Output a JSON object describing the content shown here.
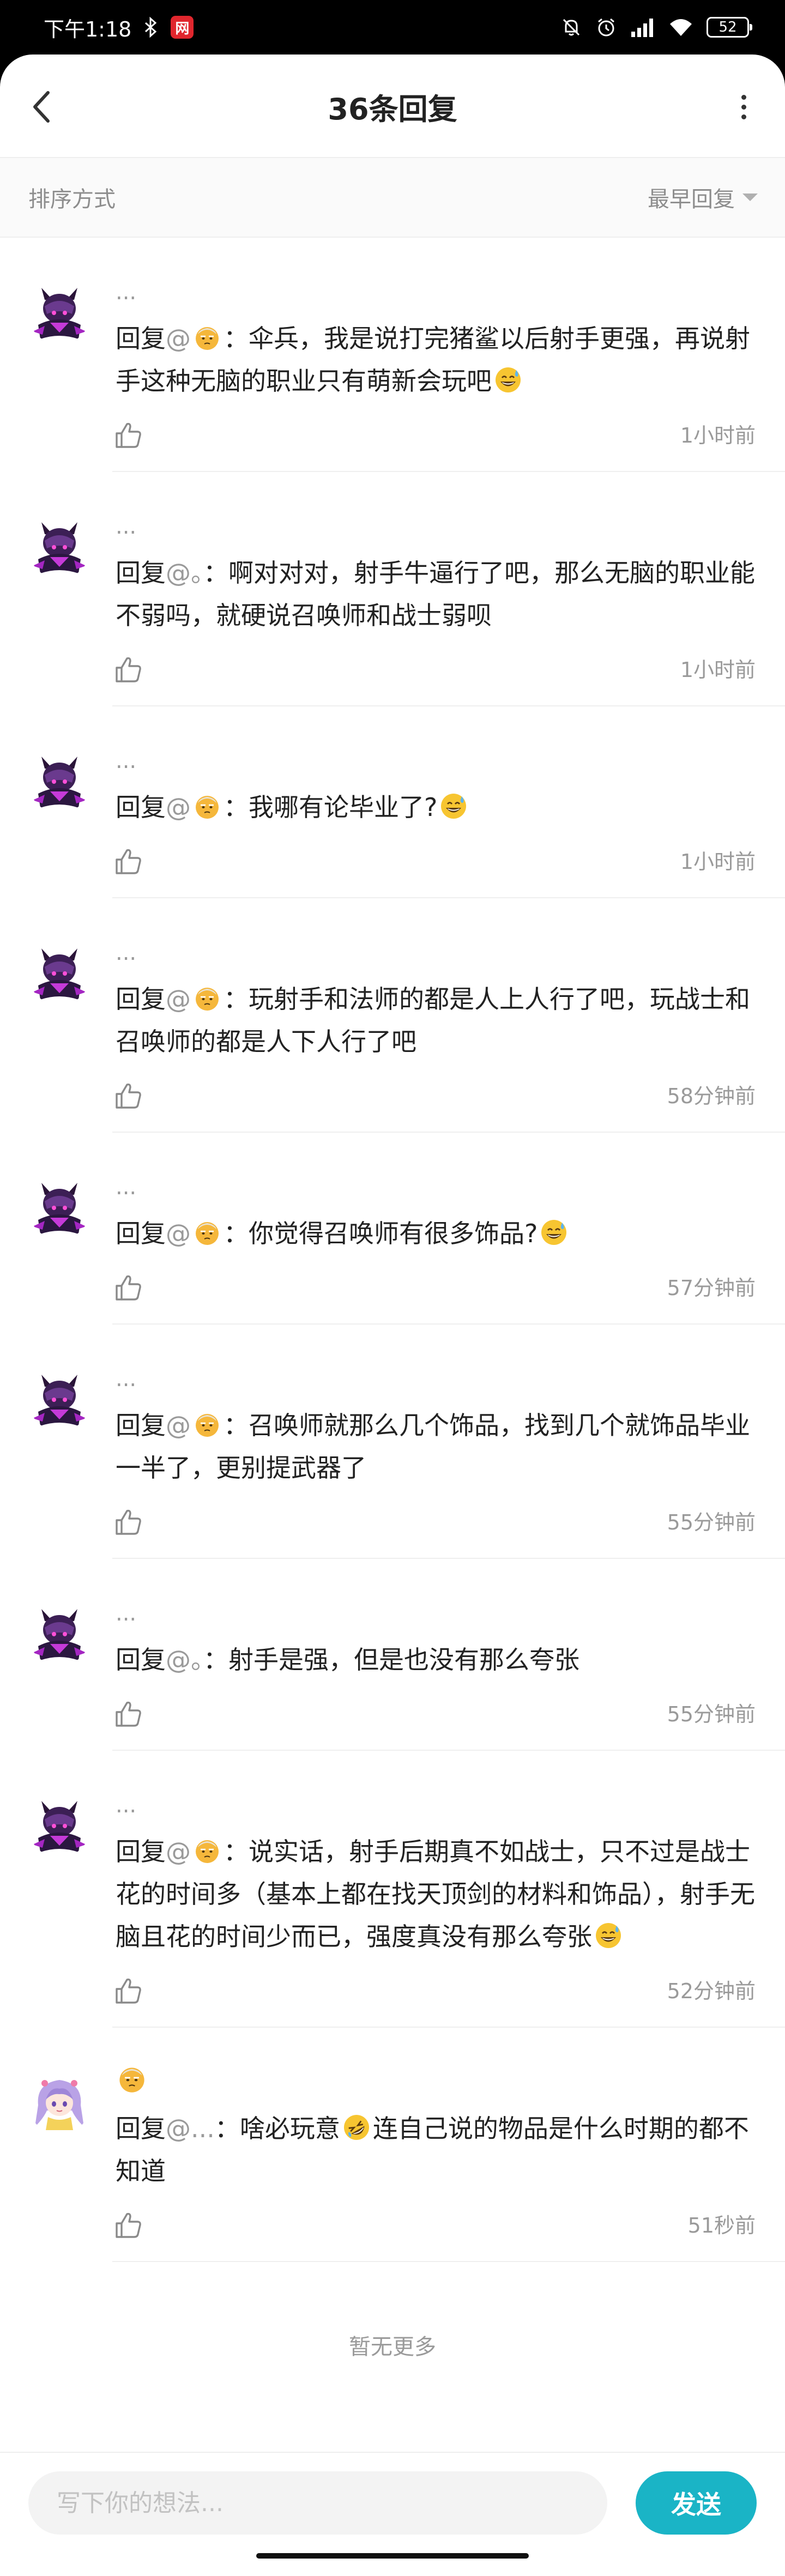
{
  "status_bar": {
    "time": "下午1:18",
    "netease_icon": "网",
    "battery": "52",
    "icons": [
      "bluetooth-icon",
      "netease-app-icon",
      "mute-bell-icon",
      "alarm-icon",
      "signal-icon",
      "wifi-icon",
      "battery-icon"
    ]
  },
  "header": {
    "title": "36条回复",
    "back_icon": "chevron-left-icon",
    "more_icon": "vertical-dots-icon"
  },
  "sort": {
    "label": "排序方式",
    "selected": "最早回复"
  },
  "colors": {
    "accent": "#1ab4c6",
    "text": "#222222",
    "muted": "#9a9a9a",
    "divider": "#efefef"
  },
  "comments": [
    {
      "author": "...",
      "avatar": "purple-armor-character-avatar",
      "reply_prefix": "回复",
      "mention": "@",
      "mention_emoji": "old-man-emoji",
      "text": "：伞兵，我是说打完猪鲨以后射手更强，再说射手这种无脑的职业只有萌新会玩吧",
      "end_emoji": "sweat-smile-emoji",
      "time": "1小时前"
    },
    {
      "author": "...",
      "avatar": "purple-armor-character-avatar",
      "reply_prefix": "回复",
      "mention": "@。",
      "text": "：啊对对对，射手牛逼行了吧，那么无脑的职业能不弱吗，就硬说召唤师和战士弱呗",
      "time": "1小时前"
    },
    {
      "author": "...",
      "avatar": "purple-armor-character-avatar",
      "reply_prefix": "回复",
      "mention": "@",
      "mention_emoji": "old-man-emoji",
      "text": "：我哪有论毕业了?",
      "end_emoji": "sweat-smile-emoji",
      "time": "1小时前"
    },
    {
      "author": "...",
      "avatar": "purple-armor-character-avatar",
      "reply_prefix": "回复",
      "mention": "@",
      "mention_emoji": "old-man-emoji",
      "text": "：玩射手和法师的都是人上人行了吧，玩战士和召唤师的都是人下人行了吧",
      "time": "58分钟前"
    },
    {
      "author": "...",
      "avatar": "purple-armor-character-avatar",
      "reply_prefix": "回复",
      "mention": "@",
      "mention_emoji": "old-man-emoji",
      "text": "：你觉得召唤师有很多饰品?",
      "end_emoji": "sweat-smile-emoji",
      "time": "57分钟前"
    },
    {
      "author": "...",
      "avatar": "purple-armor-character-avatar",
      "reply_prefix": "回复",
      "mention": "@",
      "mention_emoji": "old-man-emoji",
      "text": "：召唤师就那么几个饰品，找到几个就饰品毕业一半了，更别提武器了",
      "time": "55分钟前"
    },
    {
      "author": "...",
      "avatar": "purple-armor-character-avatar",
      "reply_prefix": "回复",
      "mention": "@。",
      "text": "：射手是强，但是也没有那么夸张",
      "time": "55分钟前"
    },
    {
      "author": "...",
      "avatar": "purple-armor-character-avatar",
      "reply_prefix": "回复",
      "mention": "@",
      "mention_emoji": "old-man-emoji",
      "text": "：说实话，射手后期真不如战士，只不过是战士花的时间多（基本上都在找天顶剑的材料和饰品），射手无脑且花的时间少而已，强度真没有那么夸张",
      "end_emoji": "sweat-smile-emoji",
      "time": "52分钟前"
    },
    {
      "author": "",
      "author_emoji": "old-man-emoji",
      "avatar": "anime-girl-avatar",
      "reply_prefix": "回复",
      "mention": "@...",
      "text_before": "：啥必玩意",
      "mid_emoji": "rolling-laugh-emoji",
      "text": "连自己说的物品是什么时期的都不知道",
      "time": "51秒前"
    }
  ],
  "footer_note": "暂无更多",
  "composer": {
    "placeholder": "写下你的想法...",
    "send_label": "发送"
  }
}
